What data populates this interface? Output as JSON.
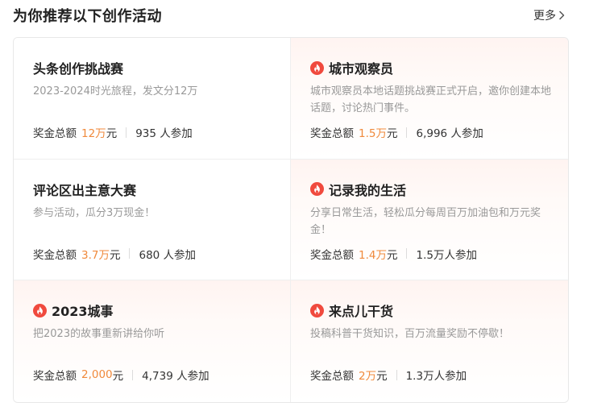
{
  "section": {
    "title": "为你推荐以下创作活动",
    "more_label": "更多"
  },
  "colors": {
    "accent": "#f08a3c",
    "fire": "#f04a3e",
    "hot_bg": "#fff4f1"
  },
  "activities": [
    {
      "title": "头条创作挑战赛",
      "hot": false,
      "description": "2023-2024时光旅程，发文分12万",
      "prize_label": "奖金总额",
      "prize_amount": "12万",
      "prize_unit": "元",
      "participants": "935 人参加"
    },
    {
      "title": "城市观察员",
      "hot": true,
      "icon": "fire-icon",
      "description": "城市观察员本地话题挑战赛正式开启，邀你创建本地话题，讨论热门事件。",
      "prize_label": "奖金总额",
      "prize_amount": "1.5万",
      "prize_unit": "元",
      "participants": "6,996 人参加"
    },
    {
      "title": "评论区出主意大赛",
      "hot": false,
      "description": "参与活动，瓜分3万现金！",
      "prize_label": "奖金总额",
      "prize_amount": "3.7万",
      "prize_unit": "元",
      "participants": "680 人参加"
    },
    {
      "title": "记录我的生活",
      "hot": true,
      "icon": "fire-icon",
      "description": "分享日常生活，轻松瓜分每周百万加油包和万元奖金！",
      "prize_label": "奖金总额",
      "prize_amount": "1.4万",
      "prize_unit": "元",
      "participants": "1.5万人参加"
    },
    {
      "title": "2023城事",
      "hot": true,
      "icon": "fire-icon",
      "description": "把2023的故事重新讲给你听",
      "prize_label": "奖金总额",
      "prize_amount": "2,000",
      "prize_unit": " 元",
      "participants": "4,739 人参加"
    },
    {
      "title": "来点儿干货",
      "hot": true,
      "icon": "fire-icon",
      "description": "投稿科普干货知识，百万流量奖励不停歇！",
      "prize_label": "奖金总额",
      "prize_amount": "2万",
      "prize_unit": "元",
      "participants": "1.3万人参加"
    }
  ]
}
